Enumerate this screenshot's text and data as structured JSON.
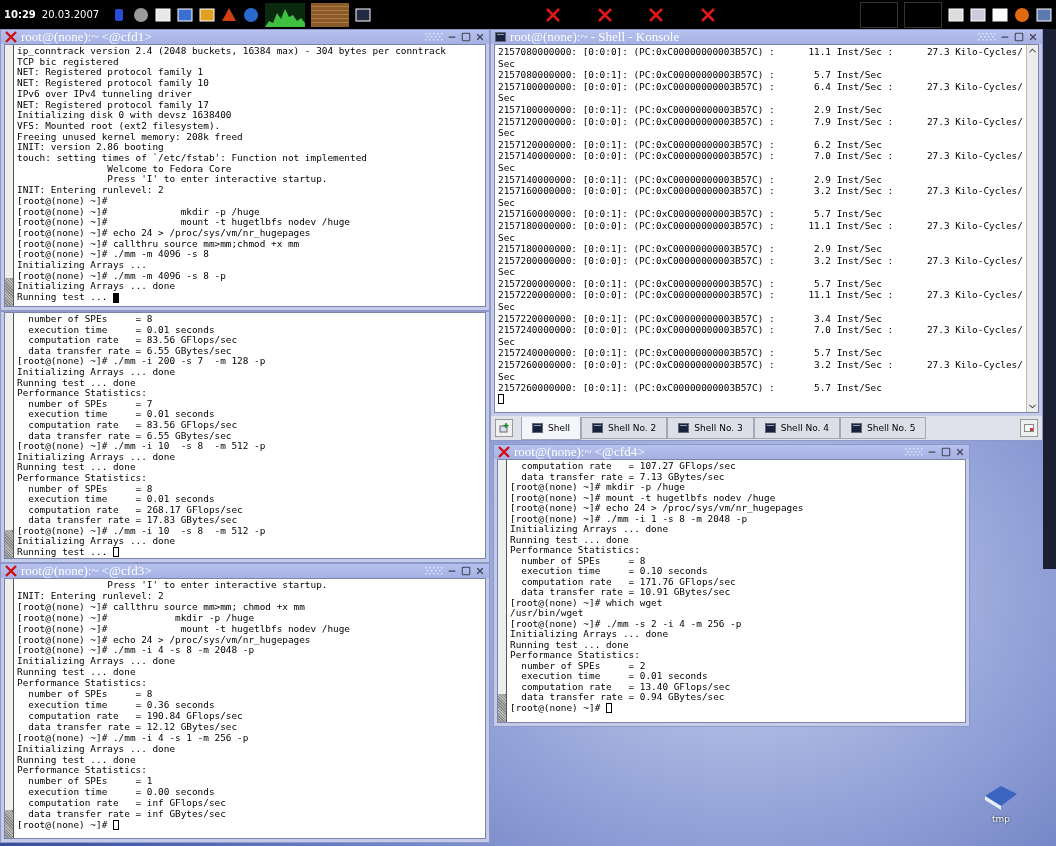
{
  "taskbar": {
    "clock": "10:29",
    "date": "20.03.2007"
  },
  "windows": [
    {
      "kind": "xterm",
      "title": "root@(none):~ <@cfd1>",
      "focused": true,
      "lines": [
        "ip_conntrack version 2.4 (2048 buckets, 16384 max) - 304 bytes per conntrack",
        "TCP bic registered",
        "NET: Registered protocol family 1",
        "NET: Registered protocol family 10",
        "IPv6 over IPv4 tunneling driver",
        "NET: Registered protocol family 17",
        "Initializing disk 0 with devsz 1638400",
        "VFS: Mounted root (ext2 filesystem).",
        "Freeing unused kernel memory: 208k freed",
        "INIT: version 2.86 booting",
        "touch: setting times of `/etc/fstab': Function not implemented",
        "                Welcome to Fedora Core",
        "                Press 'I' to enter interactive startup.",
        "INIT: Entering runlevel: 2",
        "[root@(none) ~]#",
        "[root@(none) ~]#             mkdir -p /huge",
        "[root@(none) ~]#             mount -t hugetlbfs nodev /huge",
        "[root@(none) ~]# echo 24 > /proc/sys/vm/nr_hugepages",
        "[root@(none) ~]# callthru source mm>mm;chmod +x mm",
        "[root@(none) ~]# ./mm -m 4096 -s 8",
        "Initializing Arrays ...",
        "[root@(none) ~]# ./mm -m 4096 -s 8 -p",
        "Initializing Arrays ... done",
        "Running test ..."
      ]
    },
    {
      "kind": "xterm",
      "focused": false,
      "lines": [
        "  number of SPEs     = 8",
        "  execution time     = 0.01 seconds",
        "  computation rate   = 83.56 GFlops/sec",
        "  data transfer rate = 6.55 GBytes/sec",
        "[root@(none) ~]# ./mm -i 200 -s 7  -m 128 -p",
        "Initializing Arrays ... done",
        "Running test ... done",
        "Performance Statistics:",
        "  number of SPEs     = 7",
        "  execution time     = 0.01 seconds",
        "  computation rate   = 83.56 GFlops/sec",
        "  data transfer rate = 6.55 GBytes/sec",
        "[root@(none) ~]# ./mm -i 10  -s 8  -m 512 -p",
        "Initializing Arrays ... done",
        "Running test ... done",
        "Performance Statistics:",
        "  number of SPEs     = 8",
        "  execution time     = 0.01 seconds",
        "  computation rate   = 268.17 GFlops/sec",
        "  data transfer rate = 17.83 GBytes/sec",
        "[root@(none) ~]# ./mm -i 10  -s 8  -m 512 -p",
        "Initializing Arrays ... done",
        "Running test ..."
      ]
    },
    {
      "kind": "xterm",
      "title": "root@(none):~ <@cfd3>",
      "focused": false,
      "lines": [
        "                Press 'I' to enter interactive startup.",
        "INIT: Entering runlevel: 2",
        "[root@(none) ~]# callthru source mm>mm; chmod +x mm",
        "[root@(none) ~]#            mkdir -p /huge",
        "[root@(none) ~]#             mount -t hugetlbfs nodev /huge",
        "[root@(none) ~]# echo 24 > /proc/sys/vm/nr_hugepages",
        "[root@(none) ~]# ./mm -i 4 -s 8 -m 2048 -p",
        "Initializing Arrays ... done",
        "Running test ... done",
        "Performance Statistics:",
        "  number of SPEs     = 8",
        "  execution time     = 0.36 seconds",
        "  computation rate   = 190.84 GFlops/sec",
        "  data transfer rate = 12.12 GBytes/sec",
        "[root@(none) ~]# ./mm -i 4 -s 1 -m 256 -p",
        "Initializing Arrays ... done",
        "Running test ... done",
        "Performance Statistics:",
        "  number of SPEs     = 1",
        "  execution time     = 0.00 seconds",
        "  computation rate   = inf GFlops/sec",
        "  data transfer rate = inf GBytes/sec",
        "[root@(none) ~]#"
      ]
    },
    {
      "kind": "konsole",
      "title": "root@(none):~ - Shell - Konsole",
      "focused": false,
      "lines": [
        "2157080000000: [0:0:0]: (PC:0xC00000000003B57C) :      11.1 Inst/Sec :      27.3 Kilo-Cycles/",
        "Sec",
        "2157080000000: [0:0:1]: (PC:0xC00000000003B57C) :       5.7 Inst/Sec",
        "2157100000000: [0:0:0]: (PC:0xC00000000003B57C) :       6.4 Inst/Sec :      27.3 Kilo-Cycles/",
        "Sec",
        "2157100000000: [0:0:1]: (PC:0xC00000000003B57C) :       2.9 Inst/Sec",
        "2157120000000: [0:0:0]: (PC:0xC00000000003B57C) :       7.9 Inst/Sec :      27.3 Kilo-Cycles/",
        "Sec",
        "2157120000000: [0:0:1]: (PC:0xC00000000003B57C) :       6.2 Inst/Sec",
        "2157140000000: [0:0:0]: (PC:0xC00000000003B57C) :       7.0 Inst/Sec :      27.3 Kilo-Cycles/",
        "Sec",
        "2157140000000: [0:0:1]: (PC:0xC00000000003B57C) :       2.9 Inst/Sec",
        "2157160000000: [0:0:0]: (PC:0xC00000000003B57C) :       3.2 Inst/Sec :      27.3 Kilo-Cycles/",
        "Sec",
        "2157160000000: [0:0:1]: (PC:0xC00000000003B57C) :       5.7 Inst/Sec",
        "2157180000000: [0:0:0]: (PC:0xC00000000003B57C) :      11.1 Inst/Sec :      27.3 Kilo-Cycles/",
        "Sec",
        "2157180000000: [0:0:1]: (PC:0xC00000000003B57C) :       2.9 Inst/Sec",
        "2157200000000: [0:0:0]: (PC:0xC00000000003B57C) :       3.2 Inst/Sec :      27.3 Kilo-Cycles/",
        "Sec",
        "2157200000000: [0:0:1]: (PC:0xC00000000003B57C) :       5.7 Inst/Sec",
        "2157220000000: [0:0:0]: (PC:0xC00000000003B57C) :      11.1 Inst/Sec :      27.3 Kilo-Cycles/",
        "Sec",
        "2157220000000: [0:0:1]: (PC:0xC00000000003B57C) :       3.4 Inst/Sec",
        "2157240000000: [0:0:0]: (PC:0xC00000000003B57C) :       7.0 Inst/Sec :      27.3 Kilo-Cycles/",
        "Sec",
        "2157240000000: [0:0:1]: (PC:0xC00000000003B57C) :       5.7 Inst/Sec",
        "2157260000000: [0:0:0]: (PC:0xC00000000003B57C) :       3.2 Inst/Sec :      27.3 Kilo-Cycles/",
        "Sec",
        "2157260000000: [0:0:1]: (PC:0xC00000000003B57C) :       5.7 Inst/Sec"
      ],
      "tabs": [
        {
          "label": "Shell",
          "selected": true
        },
        {
          "label": "Shell No. 2",
          "selected": false
        },
        {
          "label": "Shell No. 3",
          "selected": false
        },
        {
          "label": "Shell No. 4",
          "selected": false
        },
        {
          "label": "Shell No. 5",
          "selected": false
        }
      ]
    },
    {
      "kind": "xterm",
      "title": "root@(none):~ <@cfd4>",
      "focused": false,
      "lines": [
        "  computation rate   = 107.27 GFlops/sec",
        "  data transfer rate = 7.13 GBytes/sec",
        "[root@(none) ~]# mkdir -p /huge",
        "[root@(none) ~]# mount -t hugetlbfs nodev /huge",
        "[root@(none) ~]# echo 24 > /proc/sys/vm/nr_hugepages",
        "[root@(none) ~]# ./mm -i 1 -s 8 -m 2048 -p",
        "Initializing Arrays ... done",
        "Running test ... done",
        "Performance Statistics:",
        "  number of SPEs     = 8",
        "  execution time     = 0.10 seconds",
        "  computation rate   = 171.76 GFlops/sec",
        "  data transfer rate = 10.91 GBytes/sec",
        "[root@(none) ~]# which wget",
        "/usr/bin/wget",
        "[root@(none) ~]# ./mm -s 2 -i 4 -m 256 -p",
        "Initializing Arrays ... done",
        "Running test ... done",
        "Performance Statistics:",
        "  number of SPEs     = 2",
        "  execution time     = 0.01 seconds",
        "  computation rate   = 13.40 GFlops/sec",
        "  data transfer rate = 0.94 GBytes/sec",
        "[root@(none) ~]#"
      ]
    }
  ],
  "desktop_icons": [
    {
      "label": "tmp"
    }
  ]
}
